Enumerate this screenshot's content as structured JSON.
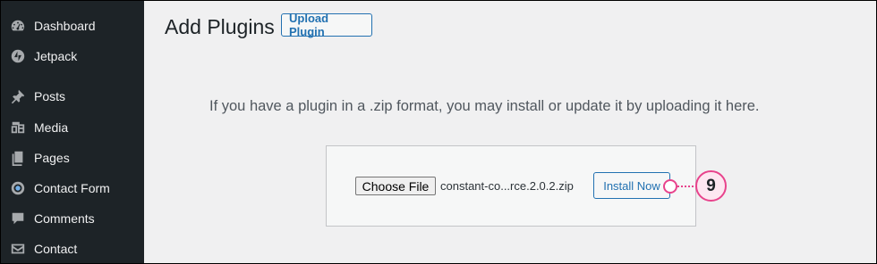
{
  "sidebar": {
    "items": [
      {
        "label": "Dashboard",
        "icon": "dashboard-icon"
      },
      {
        "label": "Jetpack",
        "icon": "jetpack-icon"
      },
      {
        "label": "Posts",
        "icon": "pin-icon"
      },
      {
        "label": "Media",
        "icon": "media-icon"
      },
      {
        "label": "Pages",
        "icon": "pages-icon"
      },
      {
        "label": "Contact Form",
        "icon": "contact-form-icon"
      },
      {
        "label": "Comments",
        "icon": "comment-icon"
      },
      {
        "label": "Contact",
        "icon": "email-icon"
      }
    ]
  },
  "header": {
    "title": "Add Plugins",
    "upload_button": "Upload Plugin"
  },
  "upload": {
    "help_text": "If you have a plugin in a .zip format, you may install or update it by uploading it here.",
    "choose_file_label": "Choose File",
    "file_name": "constant-co...rce.2.0.2.zip",
    "install_label": "Install Now"
  },
  "annotation": {
    "step_number": "9",
    "color": "#e8438c"
  },
  "colors": {
    "sidebar_bg": "#1d2327",
    "accent": "#2271b1",
    "page_bg": "#f0f0f1"
  }
}
